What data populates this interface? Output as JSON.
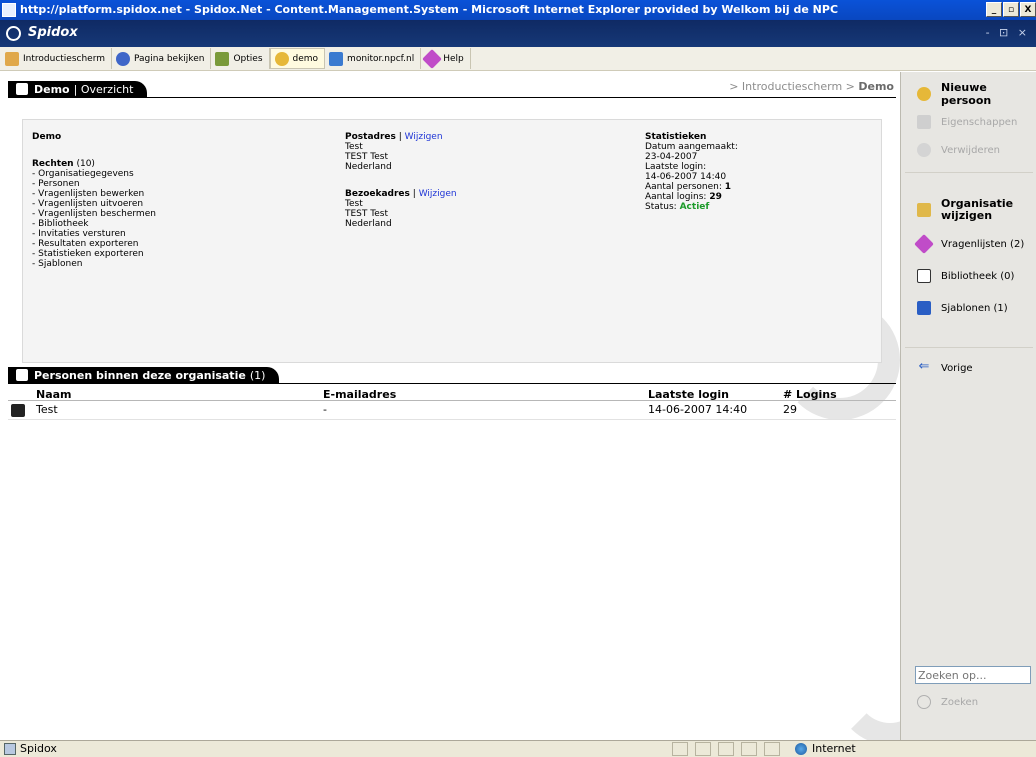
{
  "window": {
    "title": "http://platform.spidox.net - Spidox.Net - Content.Management.System - Microsoft Internet Explorer provided by Welkom bij de NPC",
    "min_label": "_",
    "max_label": "▫",
    "close_label": "X"
  },
  "app": {
    "name": "Spidox",
    "controls": "- ⊡ ×"
  },
  "toolbar": {
    "items": [
      {
        "label": "Introductiescherm",
        "icon": "home-icon"
      },
      {
        "label": "Pagina bekijken",
        "icon": "page-view-icon"
      },
      {
        "label": "Opties",
        "icon": "options-icon"
      },
      {
        "label": "demo",
        "icon": "organisation-icon"
      },
      {
        "label": "monitor.npcf.nl",
        "icon": "network-icon"
      },
      {
        "label": "Help",
        "icon": "help-icon"
      }
    ]
  },
  "header": {
    "title": "Demo",
    "separator": "|",
    "subtitle": "Overzicht",
    "breadcrumb_prefix": "> Introductiescherm >",
    "breadcrumb_current": "Demo"
  },
  "overview": {
    "org_name": "Demo",
    "rights_label": "Rechten",
    "rights_count": "(10)",
    "rights": [
      "- Organisatiegegevens",
      "- Personen",
      "- Vragenlijsten bewerken",
      "- Vragenlijsten uitvoeren",
      "- Vragenlijsten beschermen",
      "- Bibliotheek",
      "- Invitaties versturen",
      "- Resultaten exporteren",
      "- Statistieken exporteren",
      "- Sjablonen"
    ],
    "postal": {
      "heading": "Postadres",
      "sep": "|",
      "edit": "Wijzigen",
      "lines": [
        "Test",
        "TEST Test",
        "Nederland"
      ]
    },
    "visit": {
      "heading": "Bezoekadres",
      "sep": "|",
      "edit": "Wijzigen",
      "lines": [
        "Test",
        "TEST Test",
        "Nederland"
      ]
    },
    "stats": {
      "heading": "Statistieken",
      "created_label": "Datum aangemaakt:",
      "created_value": "23-04-2007",
      "last_login_label": "Laatste login:",
      "last_login_value": "14-06-2007 14:40",
      "persons_label": "Aantal personen:",
      "persons_value": "1",
      "logins_label": "Aantal logins:",
      "logins_value": "29",
      "status_label": "Status:",
      "status_value": "Actief"
    }
  },
  "persons": {
    "title": "Personen binnen deze organisatie",
    "count": "(1)",
    "columns": [
      "Naam",
      "E-mailadres",
      "Laatste login",
      "# Logins"
    ],
    "rows": [
      {
        "name": "Test",
        "email": "-",
        "last_login": "14-06-2007 14:40",
        "logins": "29"
      }
    ]
  },
  "sidebar": {
    "new_person": "Nieuwe persoon",
    "properties": "Eigenschappen",
    "delete": "Verwijderen",
    "org_edit": "Organisatie wijzigen",
    "questionnaires": "Vragenlijsten (2)",
    "library": "Bibliotheek (0)",
    "templates": "Sjablonen (1)",
    "back": "Vorige",
    "search_placeholder": "Zoeken op...",
    "search_button": "Zoeken"
  },
  "statusbar": {
    "text": "Spidox",
    "zone": "Internet"
  },
  "colors": {
    "title_bar": "#0a52d8",
    "app_bar": "#163877",
    "link": "#1f35d6",
    "status_active": "#1c9b2a",
    "sidebar_bg": "#e7e6e2"
  }
}
